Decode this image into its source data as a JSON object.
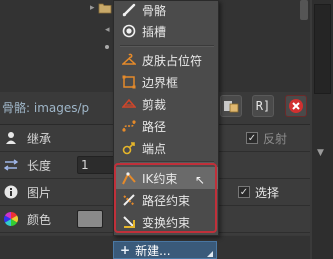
{
  "background": {
    "bone_path": "骨骼: images/p",
    "props": {
      "inherit_label": "继承",
      "reflect_label": "反射",
      "length_label": "长度",
      "length_value": "1",
      "image_label": "图片",
      "select_label": "选择",
      "color_label": "颜色"
    },
    "new_button_label": "新建..."
  },
  "menu": {
    "items": [
      {
        "label": "骨骼"
      },
      {
        "label": "插槽"
      },
      {
        "label": "皮肤占位符"
      },
      {
        "label": "边界框"
      },
      {
        "label": "剪裁"
      },
      {
        "label": "路径"
      },
      {
        "label": "端点"
      },
      {
        "label": "IK约束"
      },
      {
        "label": "路径约束"
      },
      {
        "label": "变换约束"
      }
    ]
  },
  "colors": {
    "accent": "#e58a2a",
    "highlight": "#c0303a",
    "new_button": "#3a5a7a"
  }
}
